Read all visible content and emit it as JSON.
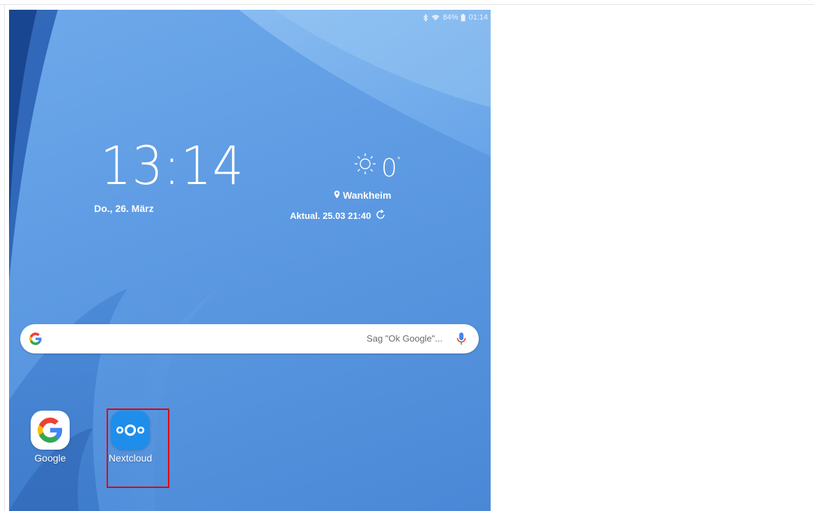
{
  "status_bar": {
    "battery": "84%",
    "time": "01:14",
    "icons": [
      "bluetooth-icon",
      "wifi-icon",
      "battery-icon"
    ]
  },
  "clock": {
    "time": "13:14",
    "date": "Do., 26. März"
  },
  "weather": {
    "icon": "sun-icon",
    "temperature": "0",
    "degree": "°",
    "location": "Wankheim",
    "updated": "Aktual. 25.03 21:40"
  },
  "search": {
    "hint": "Sag \"Ok Google\"...",
    "icons": [
      "google-g-icon",
      "microphone-icon"
    ]
  },
  "apps": [
    {
      "label": "Google",
      "icon": "google-app-icon"
    },
    {
      "label": "Nextcloud",
      "icon": "nextcloud-app-icon"
    }
  ],
  "colors": {
    "wallpaper": "#5e9be3",
    "nextcloud": "#1f8eea",
    "highlight": "#e00000"
  }
}
